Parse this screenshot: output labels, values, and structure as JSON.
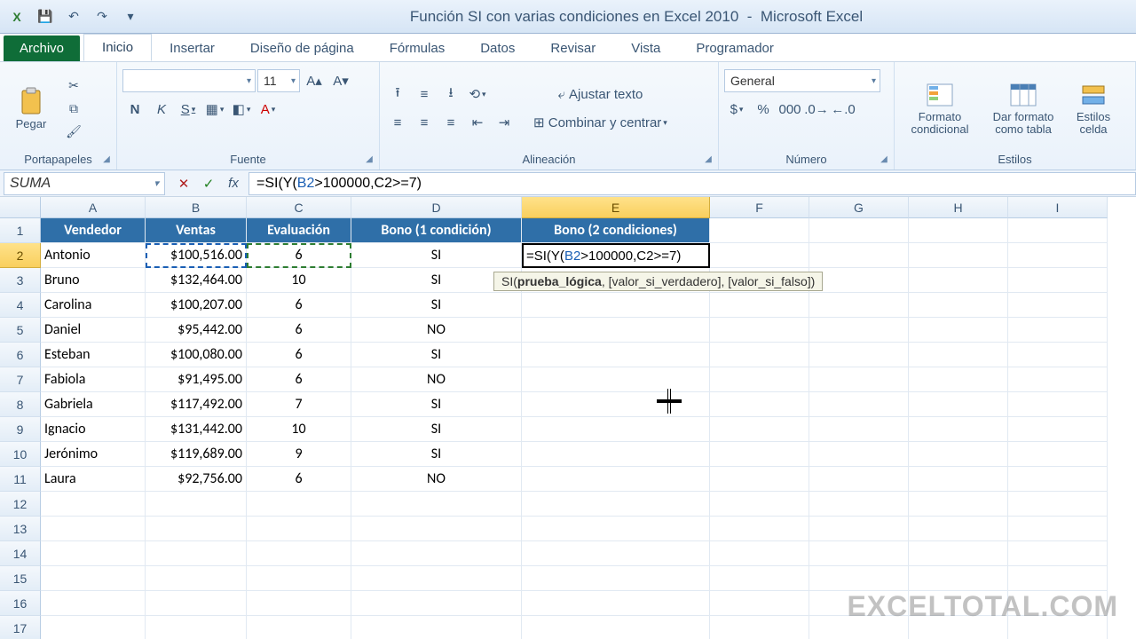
{
  "title": {
    "doc": "Función SI con varias condiciones en Excel 2010",
    "app": "Microsoft Excel"
  },
  "tabs": {
    "file": "Archivo",
    "items": [
      "Inicio",
      "Insertar",
      "Diseño de página",
      "Fórmulas",
      "Datos",
      "Revisar",
      "Vista",
      "Programador"
    ],
    "active": 0
  },
  "ribbon": {
    "clipboard": {
      "label": "Portapapeles",
      "paste": "Pegar"
    },
    "font": {
      "label": "Fuente",
      "name": "",
      "size": "11"
    },
    "alignment": {
      "label": "Alineación",
      "wrap": "Ajustar texto",
      "merge": "Combinar y centrar"
    },
    "number": {
      "label": "Número",
      "format": "General"
    },
    "styles": {
      "label": "Estilos",
      "cond": "Formato condicional",
      "table": "Dar formato como tabla",
      "cell": "Estilos celda"
    }
  },
  "formula_bar": {
    "name_box": "SUMA",
    "formula_plain": "=SI(Y(B2>100000,C2>=7)",
    "formula_parts": [
      "=SI(Y(",
      "B2",
      ">100000,C2>=7)"
    ]
  },
  "columns": [
    "A",
    "B",
    "C",
    "D",
    "E",
    "F",
    "G",
    "H",
    "I"
  ],
  "active_col": "E",
  "active_row": "2",
  "headers": {
    "A": "Vendedor",
    "B": "Ventas",
    "C": "Evaluación",
    "D": "Bono (1 condición)",
    "E": "Bono (2 condiciones)"
  },
  "rows": [
    {
      "A": "Antonio",
      "B": "$100,516.00",
      "C": "6",
      "D": "SI"
    },
    {
      "A": "Bruno",
      "B": "$132,464.00",
      "C": "10",
      "D": "SI"
    },
    {
      "A": "Carolina",
      "B": "$100,207.00",
      "C": "6",
      "D": "SI"
    },
    {
      "A": "Daniel",
      "B": "$95,442.00",
      "C": "6",
      "D": "NO"
    },
    {
      "A": "Esteban",
      "B": "$100,080.00",
      "C": "6",
      "D": "SI"
    },
    {
      "A": "Fabiola",
      "B": "$91,495.00",
      "C": "6",
      "D": "NO"
    },
    {
      "A": "Gabriela",
      "B": "$117,492.00",
      "C": "7",
      "D": "SI"
    },
    {
      "A": "Ignacio",
      "B": "$131,442.00",
      "C": "10",
      "D": "SI"
    },
    {
      "A": "Jerónimo",
      "B": "$119,689.00",
      "C": "9",
      "D": "SI"
    },
    {
      "A": "Laura",
      "B": "$92,756.00",
      "C": "6",
      "D": "NO"
    }
  ],
  "cell_edit": {
    "text": "=SI(Y(B2>100000,C2>=7)"
  },
  "tooltip": {
    "fn": "SI",
    "arg1": "prueba_lógica",
    "rest": ", [valor_si_verdadero], [valor_si_falso])"
  },
  "watermark": "EXCELTOTAL.COM",
  "chart_data": {
    "type": "table",
    "title": "Función SI con varias condiciones",
    "columns": [
      "Vendedor",
      "Ventas",
      "Evaluación",
      "Bono (1 condición)",
      "Bono (2 condiciones)"
    ],
    "data": [
      [
        "Antonio",
        100516.0,
        6,
        "SI",
        null
      ],
      [
        "Bruno",
        132464.0,
        10,
        "SI",
        null
      ],
      [
        "Carolina",
        100207.0,
        6,
        "SI",
        null
      ],
      [
        "Daniel",
        95442.0,
        6,
        "NO",
        null
      ],
      [
        "Esteban",
        100080.0,
        6,
        "SI",
        null
      ],
      [
        "Fabiola",
        91495.0,
        6,
        "NO",
        null
      ],
      [
        "Gabriela",
        117492.0,
        7,
        "SI",
        null
      ],
      [
        "Ignacio",
        131442.0,
        10,
        "SI",
        null
      ],
      [
        "Jerónimo",
        119689.0,
        9,
        "SI",
        null
      ],
      [
        "Laura",
        92756.0,
        6,
        "NO",
        null
      ]
    ]
  }
}
